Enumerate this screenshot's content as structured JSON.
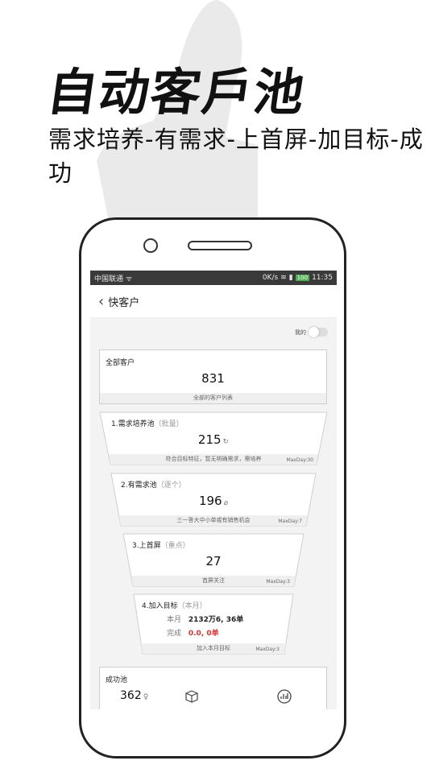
{
  "hero": {
    "title": "自动客戶池",
    "subtitle": "需求培养-有需求-上首屏-加目标-成功"
  },
  "status_bar": {
    "carrier": "中国联通",
    "speed": "0K/s",
    "battery": "100",
    "time": "11:35"
  },
  "nav": {
    "back_icon": "chevron-left-icon",
    "title": "快客户"
  },
  "mine_toggle": {
    "label": "我的",
    "on": false
  },
  "all_customers": {
    "title": "全部客户",
    "count": "831",
    "footer": "全部的客户列表"
  },
  "funnel": [
    {
      "title": "1.需求培养池",
      "tag": "（批量）",
      "count": "215",
      "icon": "refresh-icon",
      "footer": "符合目标特征，暂无明确需求，需培养",
      "maxday": "MaxDay:30"
    },
    {
      "title": "2.有需求池",
      "tag": "（逐个）",
      "count": "196",
      "icon": "leaf-icon",
      "footer": "三一答大中小单或有销售机会",
      "maxday": "MaxDay:7"
    },
    {
      "title": "3.上首屏",
      "tag": "（重点）",
      "count": "27",
      "footer": "首屏关注",
      "maxday": "MaxDay:3"
    }
  ],
  "goal": {
    "title": "4.加入目标",
    "tag": "（本月）",
    "month_label": "本月",
    "month_value": "2132万6, 36单",
    "done_label": "完成",
    "done_value": "0.0, 0单",
    "footer": "加入本月目标",
    "maxday": "MaxDay:3"
  },
  "success_pool": {
    "title": "成功池",
    "count": "362",
    "icons": [
      "bulb-icon",
      "box-icon",
      "chart-icon"
    ]
  }
}
